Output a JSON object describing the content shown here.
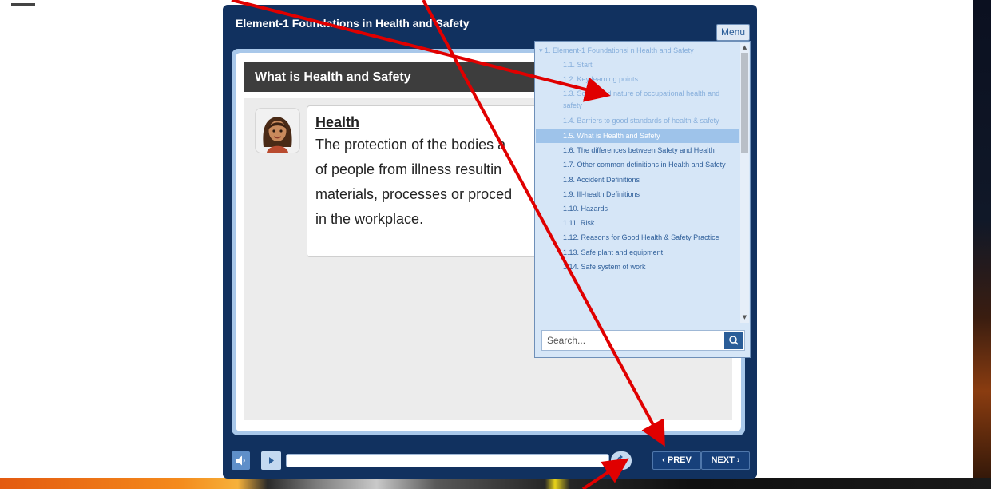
{
  "player": {
    "course_title": "Element-1 Foundations in Health and Safety",
    "menu_button_label": "Menu"
  },
  "slide": {
    "title": "What is Health and Safety",
    "heading": "Health",
    "body_lines": [
      "The protection of the bodies a",
      "of people from illness resultin",
      "materials, processes or proced",
      "in the workplace."
    ]
  },
  "menu": {
    "items": [
      {
        "label": "1. Element-1 Foundationsi n Health and Safety"
      },
      {
        "label": "1.1. Start"
      },
      {
        "label": "1.2. Key learning points"
      },
      {
        "label": "1.3. Scope and nature of occupational health and safety"
      },
      {
        "label": "1.4. Barriers to good standards of health & safety"
      },
      {
        "label": "1.5. What is Health and Safety"
      },
      {
        "label": "1.6. The differences between Safety and Health"
      },
      {
        "label": "1.7. Other common definitions in Health and Safety"
      },
      {
        "label": "1.8. Accident Definitions"
      },
      {
        "label": "1.9. Ill-health Definitions"
      },
      {
        "label": "1.10. Hazards"
      },
      {
        "label": "1.11. Risk"
      },
      {
        "label": "1.12. Reasons for Good Health & Safety Practice"
      },
      {
        "label": "1.13. Safe plant and equipment"
      },
      {
        "label": "1.14. Safe system of work"
      }
    ],
    "selected_index": 5,
    "search_placeholder": "Search..."
  },
  "controls": {
    "prev_label": "‹ PREV",
    "next_label": "NEXT ›",
    "progress": 0
  },
  "colors": {
    "player_navy": "#11315f",
    "menu_bg": "#d6e6f7",
    "selected_item": "#9ec3ea",
    "annotation_red": "#e00000"
  },
  "icons": {
    "volume": "speaker-icon",
    "play": "play-icon",
    "replay": "replay-icon",
    "search": "magnifier-icon",
    "avatar": "woman-avatar-icon"
  }
}
